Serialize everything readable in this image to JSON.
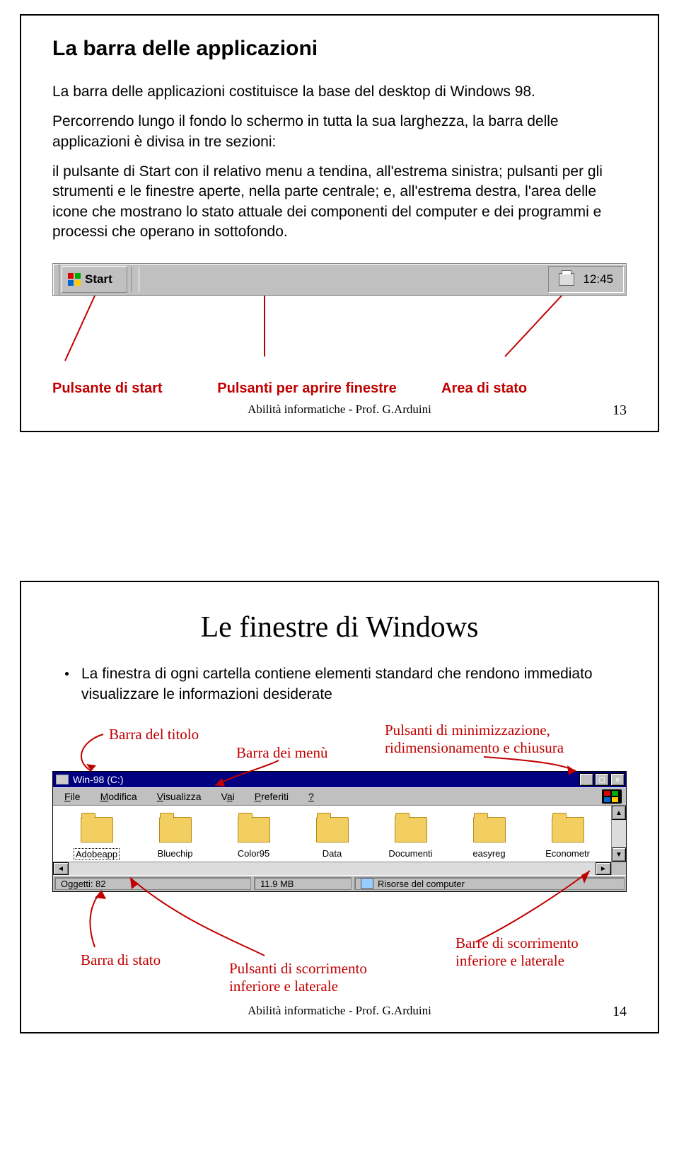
{
  "slide1": {
    "title": "La barra delle applicazioni",
    "para1": "La barra delle applicazioni costituisce la base del desktop di Windows 98.",
    "para2": "Percorrendo lungo il fondo lo schermo in tutta la sua larghezza, la barra delle applicazioni è divisa in tre sezioni:",
    "para3": "il pulsante di Start con il relativo menu a tendina, all'estrema sinistra; pulsanti per gli strumenti e le finestre aperte, nella parte centrale; e, all'estrema destra, l'area delle icone che mostrano lo stato attuale dei componenti del computer e dei programmi e processi che operano in sottofondo.",
    "taskbar": {
      "start": "Start",
      "time": "12:45"
    },
    "labels": {
      "start": "Pulsante di start",
      "middle": "Pulsanti per aprire finestre",
      "tray": "Area di stato"
    },
    "footer": "Abilità informatiche - Prof. G.Arduini",
    "pagenum": "13"
  },
  "slide2": {
    "title": "Le finestre di Windows",
    "bullet": "La finestra di ogni cartella contiene elementi standard che rendono immediato visualizzare le informazioni desiderate",
    "annot": {
      "titlebar": "Barra del titolo",
      "menubar": "Barra dei menù",
      "winctrl": "Pulsanti di minimizzazione, ridimensionamento e chiusura",
      "statusbar": "Barra di stato",
      "scrollbtns": "Pulsanti di scorrimento inferiore e laterale",
      "scrollbars": "Barre di scorrimento inferiore e laterale"
    },
    "window": {
      "title": "Win-98 (C:)",
      "menu": [
        "File",
        "Modifica",
        "Visualizza",
        "Vai",
        "Preferiti",
        "?"
      ],
      "folders": [
        "Adobeapp",
        "Bluechip",
        "Color95",
        "Data",
        "Documenti",
        "easyreg",
        "Econometr"
      ],
      "status_objects": "Oggetti: 82",
      "status_size": "11.9 MB",
      "status_loc": "Risorse del computer"
    },
    "footer": "Abilità informatiche - Prof. G.Arduini",
    "pagenum": "14"
  }
}
